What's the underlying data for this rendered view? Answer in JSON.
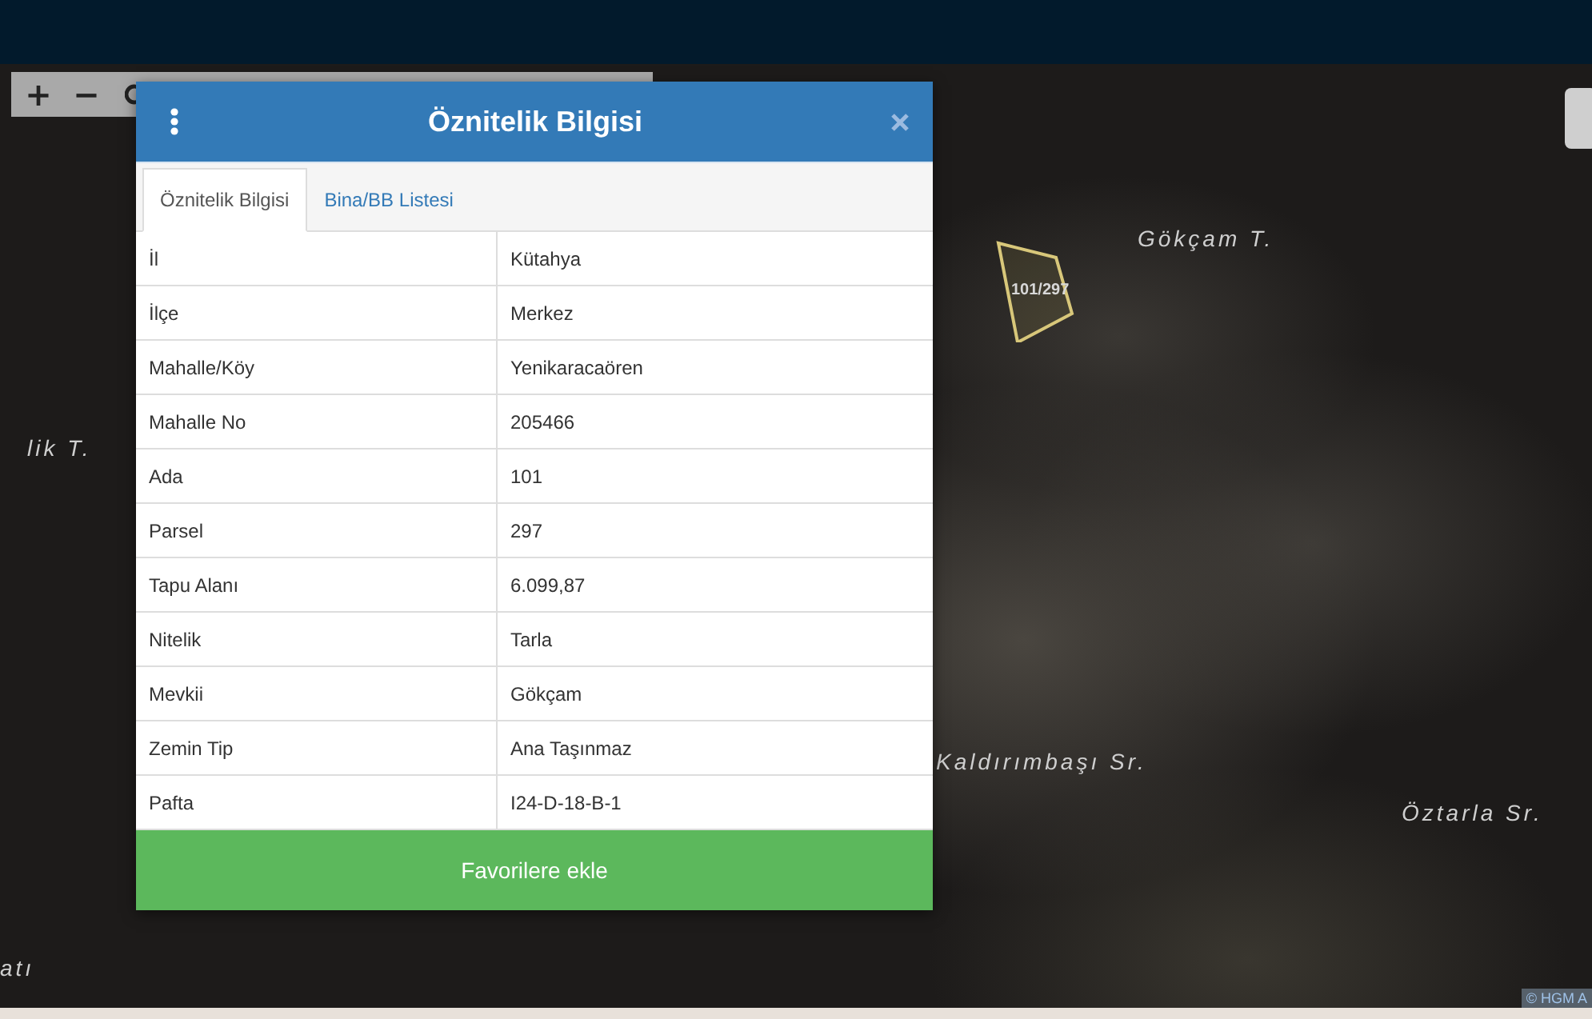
{
  "map": {
    "toolbar": [
      {
        "label": "+",
        "kind": "text"
      },
      {
        "label": "−",
        "kind": "text"
      },
      {
        "kind": "rotate"
      }
    ],
    "labels": [
      {
        "text": "Gökçam T."
      },
      {
        "text": "lik T."
      },
      {
        "text": "Kaldırımbaşı Sr."
      },
      {
        "text": "Öztarla Sr."
      },
      {
        "text": "atı"
      }
    ],
    "parcel": {
      "label": "101/297"
    },
    "attribution": "© HGM A"
  },
  "dialog": {
    "title": "Öznitelik Bilgisi",
    "tabs": [
      {
        "label": "Öznitelik Bilgisi",
        "selected": true
      },
      {
        "label": "Bina/BB Listesi",
        "selected": false
      }
    ],
    "rows": [
      {
        "label": "İl",
        "value": "Kütahya"
      },
      {
        "label": "İlçe",
        "value": "Merkez"
      },
      {
        "label": "Mahalle/Köy",
        "value": "Yenikaracaören"
      },
      {
        "label": "Mahalle No",
        "value": "205466"
      },
      {
        "label": "Ada",
        "value": "101"
      },
      {
        "label": "Parsel",
        "value": "297"
      },
      {
        "label": "Tapu Alanı",
        "value": "6.099,87"
      },
      {
        "label": "Nitelik",
        "value": "Tarla"
      },
      {
        "label": "Mevkii",
        "value": "Gökçam"
      },
      {
        "label": "Zemin Tip",
        "value": "Ana Taşınmaz"
      },
      {
        "label": "Pafta",
        "value": "I24-D-18-B-1"
      }
    ],
    "button": "Favorilere ekle"
  }
}
